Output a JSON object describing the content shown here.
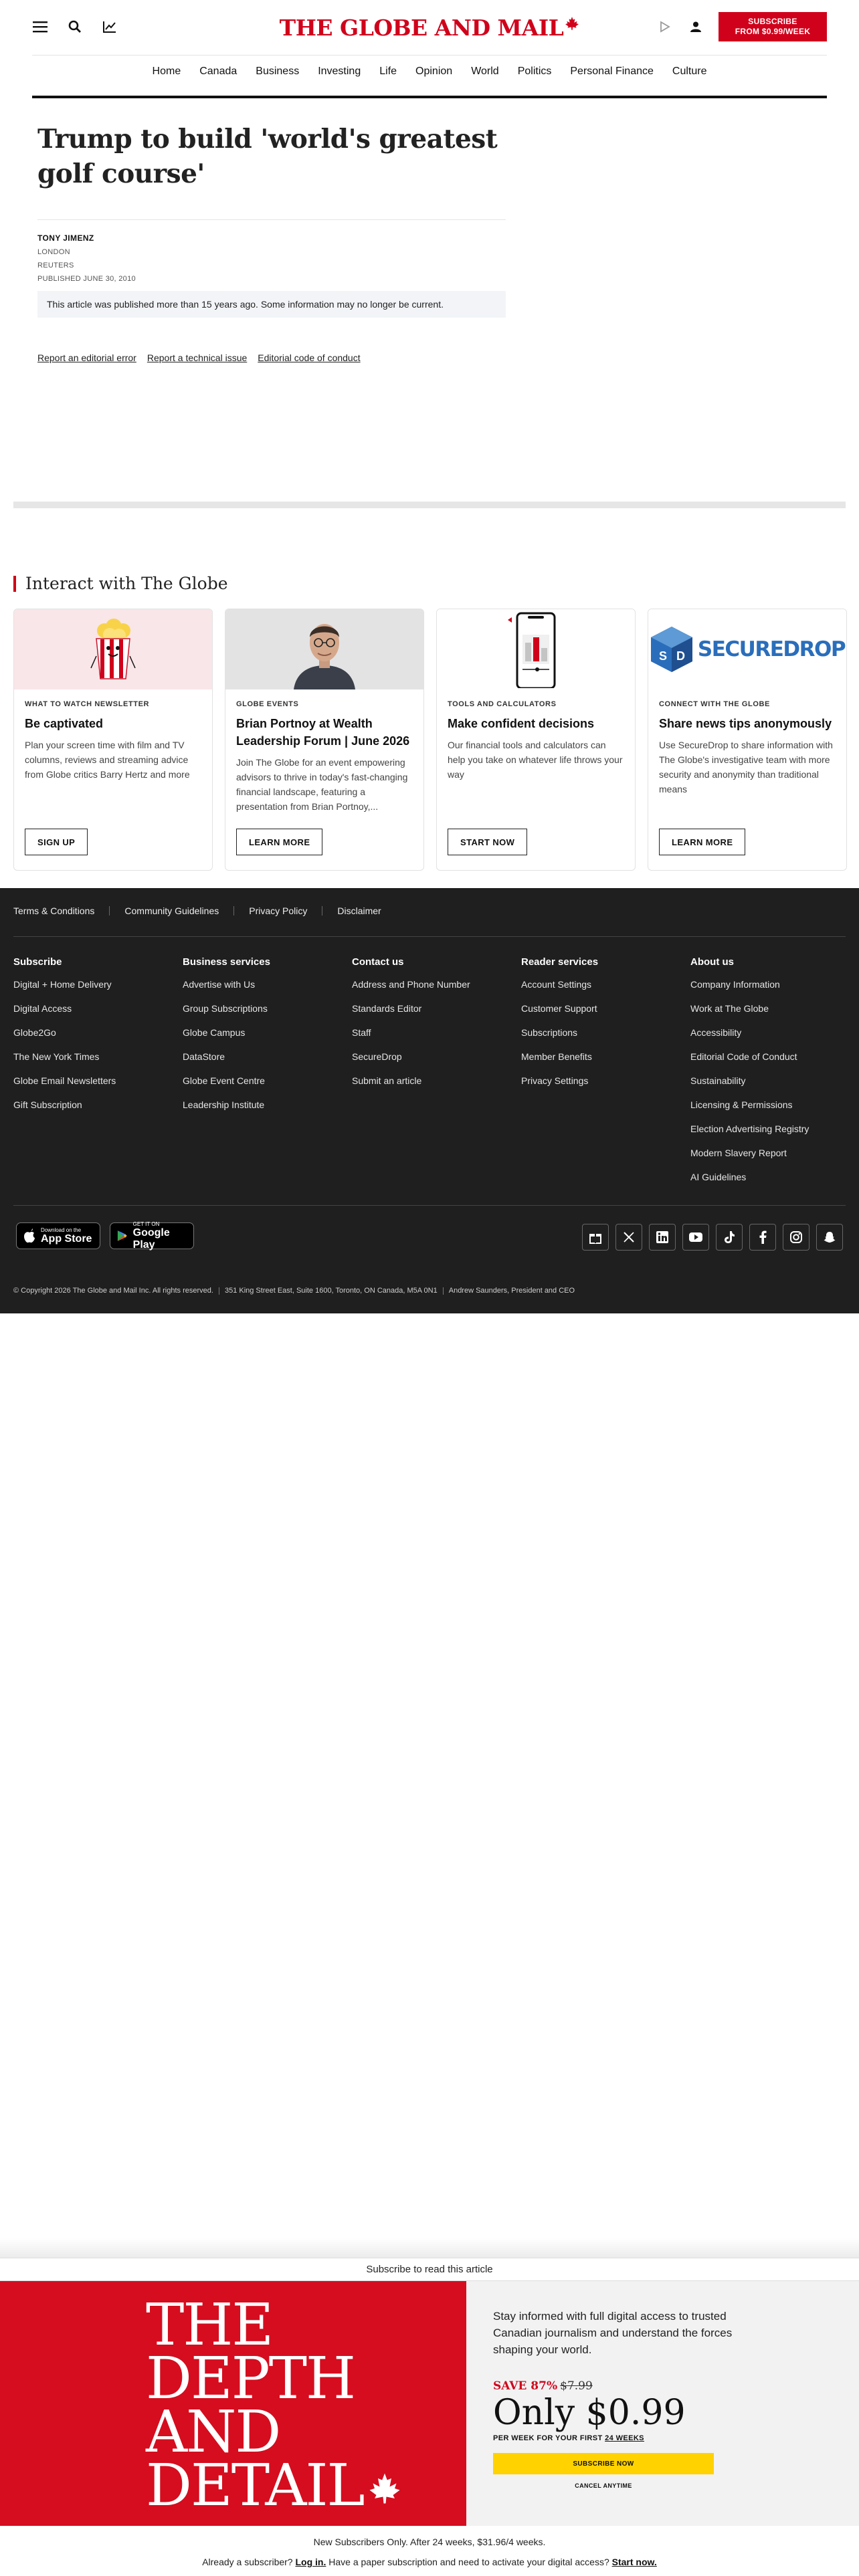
{
  "header": {
    "logo_text": "THE GLOBE AND MAIL",
    "subscribe_line1": "SUBSCRIBE",
    "subscribe_line2": "FROM $0.99/WEEK"
  },
  "nav": {
    "items": [
      "Home",
      "Canada",
      "Business",
      "Investing",
      "Life",
      "Opinion",
      "World",
      "Politics",
      "Personal Finance",
      "Culture"
    ]
  },
  "article": {
    "headline": "Trump to build 'world's greatest golf course'",
    "author": "TONY JIMENZ",
    "location": "LONDON",
    "source": "REUTERS",
    "published": "PUBLISHED JUNE 30, 2010",
    "notice": "This article was published more than 15 years ago. Some information may no longer be current.",
    "links": [
      "Report an editorial error",
      "Report a technical issue",
      "Editorial code of conduct"
    ]
  },
  "interact": {
    "title": "Interact with The Globe",
    "cards": [
      {
        "category": "WHAT TO WATCH NEWSLETTER",
        "title": "Be captivated",
        "desc": "Plan your screen time with film and TV columns, reviews and streaming advice from Globe critics Barry Hertz and more",
        "button": "SIGN UP"
      },
      {
        "category": "GLOBE EVENTS",
        "title": "Brian Portnoy at Wealth Leadership Forum | June 2026",
        "desc": "Join The Globe for an event empowering advisors to thrive in today's fast-changing financial landscape, featuring a presentation from Brian Portnoy,...",
        "button": "LEARN MORE"
      },
      {
        "category": "TOOLS AND CALCULATORS",
        "title": "Make confident decisions",
        "desc": "Our financial tools and calculators can help you take on whatever life throws your way",
        "button": "START NOW"
      },
      {
        "category": "CONNECT WITH THE GLOBE",
        "title": "Share news tips anonymously",
        "desc": "Use SecureDrop to share information with The Globe's investigative team with more security and anonymity than traditional means",
        "button": "LEARN MORE",
        "logo_text": "SECUREDROP"
      }
    ]
  },
  "footer": {
    "top_links": [
      "Terms & Conditions",
      "Community Guidelines",
      "Privacy Policy",
      "Disclaimer"
    ],
    "columns": [
      {
        "heading": "Subscribe",
        "links": [
          "Digital + Home Delivery",
          "Digital Access",
          "Globe2Go",
          "The New York Times",
          "Globe Email Newsletters",
          "Gift Subscription"
        ]
      },
      {
        "heading": "Business services",
        "links": [
          "Advertise with Us",
          "Group Subscriptions",
          "Globe Campus",
          "DataStore",
          "Globe Event Centre",
          "Leadership Institute"
        ]
      },
      {
        "heading": "Contact us",
        "links": [
          "Address and Phone Number",
          "Standards Editor",
          "Staff",
          "SecureDrop",
          "Submit an article"
        ]
      },
      {
        "heading": "Reader services",
        "links": [
          "Account Settings",
          "Customer Support",
          "Subscriptions",
          "Member Benefits",
          "Privacy Settings"
        ]
      },
      {
        "heading": "About us",
        "links": [
          "Company Information",
          "Work at The Globe",
          "Accessibility",
          "Editorial Code of Conduct",
          "Sustainability",
          "Licensing & Permissions",
          "Election Advertising Registry",
          "Modern Slavery Report",
          "AI Guidelines"
        ]
      }
    ],
    "app_store_small": "Download on the",
    "app_store_big": "App Store",
    "google_play_small": "GET IT ON",
    "google_play_big": "Google Play",
    "copyright": "© Copyright 2026 The Globe and Mail Inc. All rights reserved.",
    "address": "351 King Street East, Suite 1600, Toronto, ON Canada, M5A 0N1",
    "president": "Andrew Saunders, President and CEO"
  },
  "paywall": {
    "heading": "Subscribe to read this article",
    "big_text": [
      "THE",
      "DEPTH",
      "AND",
      "DETAIL"
    ],
    "pitch": "Stay informed with full digital access to trusted Canadian journalism and understand the forces shaping your world.",
    "save": "SAVE 87%",
    "old_price": "$7.99",
    "price": "Only $0.99",
    "per_week_prefix": "PER WEEK FOR YOUR FIRST",
    "per_week_weeks": "24 WEEKS",
    "subscribe_button": "SUBSCRIBE NOW",
    "cancel": "CANCEL ANYTIME",
    "fineprint": "New Subscribers Only. After 24 weeks, $31.96/4 weeks.",
    "already_prefix": "Already a subscriber?",
    "login": "Log in.",
    "paper_text": "Have a paper subscription and need to activate your digital access?",
    "start_now": "Start now."
  }
}
